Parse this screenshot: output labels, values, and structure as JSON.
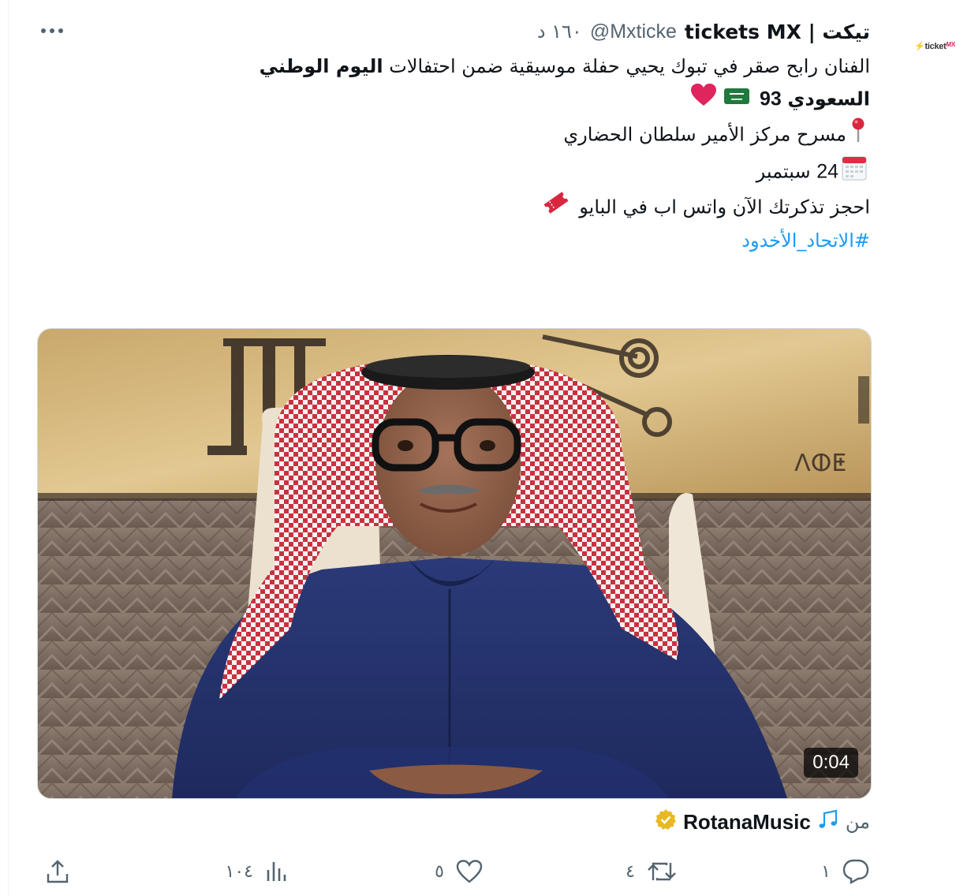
{
  "author": {
    "display_name": "تيكت | tickets MX",
    "handle": "@Mxticke",
    "time": "١٦٠ د",
    "avatar_logo": "ticket",
    "avatar_logo_suffix": "MX"
  },
  "tweet": {
    "line1": "الفنان  رابح صقر في تبوك يحيي حفلة موسيقية ضمن احتفالات ",
    "line1_bold": "اليوم الوطني",
    "line2_bold": "السعودي",
    "line2_number": "93",
    "venue": "مسرح مركز الأمير سلطان الحضاري",
    "date_number": "24",
    "date_month": "سبتمبر",
    "cta": "احجز تذكرتك الآن واتس اب في البايو",
    "hashtag": "#الاتحاد_الأخدود"
  },
  "media": {
    "duration": "0:04",
    "wall_glyphs": "ⴷⵀⵟ"
  },
  "source": {
    "label": "من",
    "name": "RotanaMusic"
  },
  "actions": {
    "replies": "١",
    "retweets": "٤",
    "likes": "٥",
    "views": "١٠٤"
  },
  "colors": {
    "accent": "#1d9bf0",
    "text": "#0f1419",
    "muted": "#536471",
    "heart": "#e0245e",
    "verified": "#e8b923"
  }
}
